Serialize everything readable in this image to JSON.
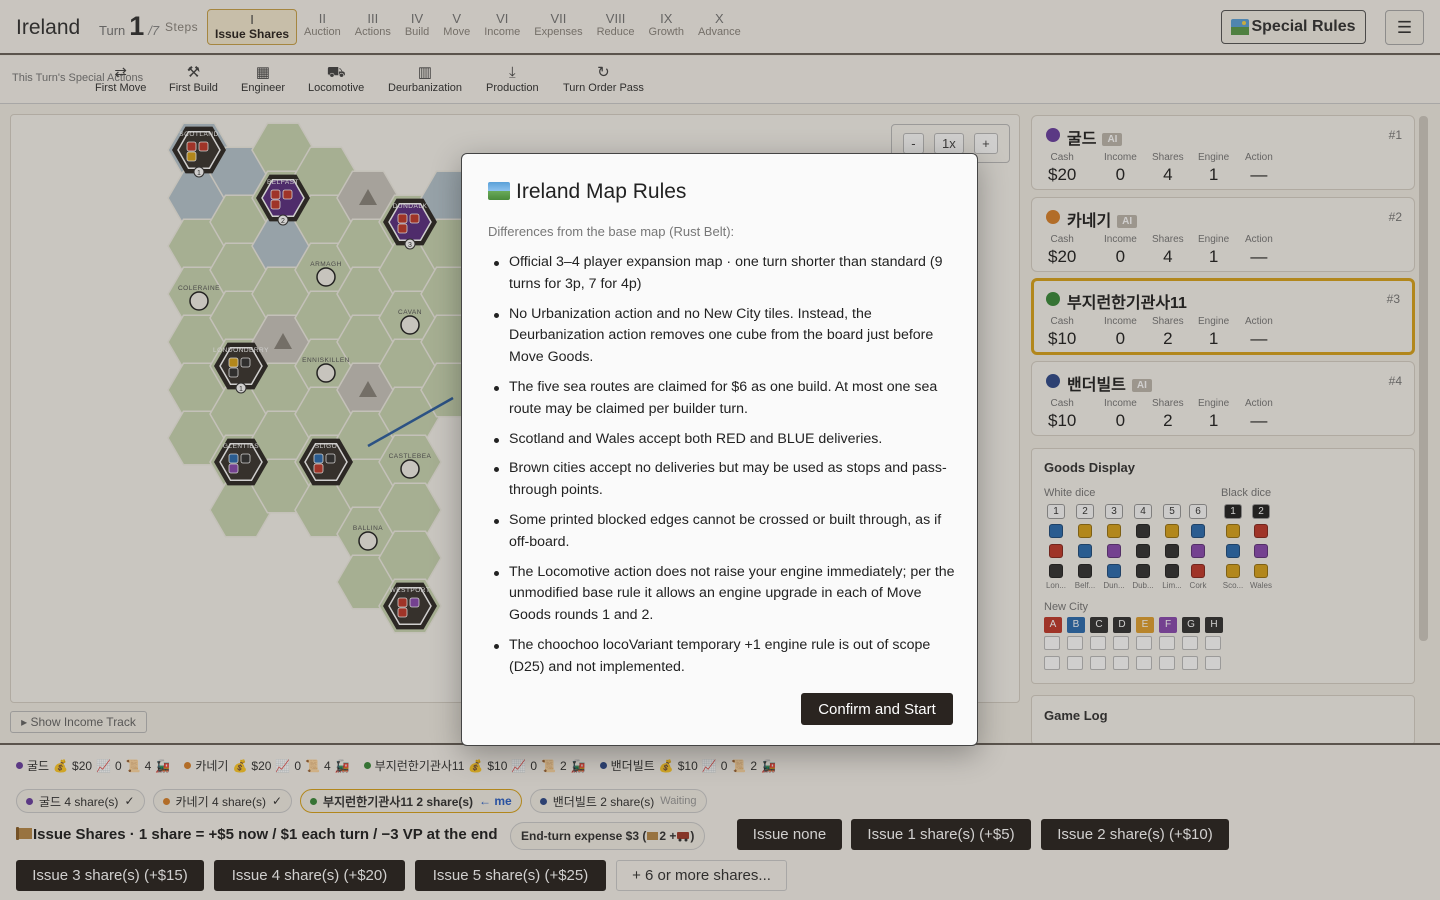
{
  "header": {
    "brand": "Ireland",
    "turn_label": "Turn",
    "turn_number": "1",
    "turn_total": "/7",
    "steps_label": "Steps",
    "steps": [
      {
        "numeral": "I",
        "label": "Issue Shares",
        "active": true
      },
      {
        "numeral": "II",
        "label": "Auction"
      },
      {
        "numeral": "III",
        "label": "Actions"
      },
      {
        "numeral": "IV",
        "label": "Build"
      },
      {
        "numeral": "V",
        "label": "Move"
      },
      {
        "numeral": "VI",
        "label": "Income"
      },
      {
        "numeral": "VII",
        "label": "Expenses"
      },
      {
        "numeral": "VIII",
        "label": "Reduce"
      },
      {
        "numeral": "IX",
        "label": "Growth"
      },
      {
        "numeral": "X",
        "label": "Advance"
      }
    ],
    "special_rules_label": "Special Rules",
    "menu_icon": "hamburger-icon"
  },
  "special_actions": {
    "title": "This Turn's Special Actions",
    "items": [
      {
        "label": "First Move",
        "icon": "arrows-icon"
      },
      {
        "label": "First Build",
        "icon": "hammer-icon"
      },
      {
        "label": "Engineer",
        "icon": "grid-icon"
      },
      {
        "label": "Locomotive",
        "icon": "train-icon"
      },
      {
        "label": "Deurbanization",
        "icon": "city-icon"
      },
      {
        "label": "Production",
        "icon": "download-icon"
      },
      {
        "label": "Turn Order Pass",
        "icon": "refresh-icon"
      }
    ]
  },
  "map": {
    "zoom_minus": "-",
    "zoom_level": "1x",
    "zoom_plus": "+",
    "cities": [
      {
        "name": "SCOTLAND",
        "number": "1"
      },
      {
        "name": "BELFAST",
        "number": "2"
      },
      {
        "name": "DUNDALK",
        "number": "3"
      },
      {
        "name": "ARMAGH"
      },
      {
        "name": "COLERAINE"
      },
      {
        "name": "CAVAN"
      },
      {
        "name": "LONDONDERRY",
        "number": "1"
      },
      {
        "name": "ENNISKILLEN"
      },
      {
        "name": "GLENTIES"
      },
      {
        "name": "SLIGO"
      },
      {
        "name": "CASTLEBEA"
      },
      {
        "name": "BALLINA"
      },
      {
        "name": "WESTPORT"
      }
    ],
    "show_income_label": "▸ Show Income Track"
  },
  "players": [
    {
      "name": "굴드",
      "ai": "AI",
      "rank": "#1",
      "color": "#6a3fa0",
      "cash": "$20",
      "income": "0",
      "shares": "4",
      "engine": "1",
      "action": "—"
    },
    {
      "name": "카네기",
      "ai": "AI",
      "rank": "#2",
      "color": "#d9822b",
      "cash": "$20",
      "income": "0",
      "shares": "4",
      "engine": "1",
      "action": "—"
    },
    {
      "name": "부지런한기관사11",
      "ai": "",
      "rank": "#3",
      "color": "#3a8a3a",
      "cash": "$10",
      "income": "0",
      "shares": "2",
      "engine": "1",
      "action": "—"
    },
    {
      "name": "밴더빌트",
      "ai": "AI",
      "rank": "#4",
      "color": "#2f4a8a",
      "cash": "$10",
      "income": "0",
      "shares": "2",
      "engine": "1",
      "action": "—"
    }
  ],
  "stat_labels": {
    "cash": "Cash",
    "income": "Income",
    "shares": "Shares",
    "engine": "Engine",
    "action": "Action"
  },
  "goods": {
    "title": "Goods Display",
    "white_label": "White dice",
    "black_label": "Black dice",
    "new_city_label": "New City",
    "white_nums": [
      "1",
      "2",
      "3",
      "4",
      "5",
      "6"
    ],
    "black_nums": [
      "1",
      "2"
    ],
    "white_cities": [
      "Lon...",
      "Belf...",
      "Dun...",
      "Dub...",
      "Lim...",
      "Cork"
    ],
    "black_cities": [
      "Sco...",
      "Wales"
    ],
    "letters": [
      "A",
      "B",
      "C",
      "D",
      "E",
      "F",
      "G",
      "H"
    ],
    "letter_colors": [
      "#c0392b",
      "#2b6cb0",
      "#333333",
      "#333333",
      "#e0a030",
      "#8a4ab0",
      "#333333",
      "#333333"
    ]
  },
  "game_log": {
    "title": "Game Log"
  },
  "bottom": {
    "summary": [
      {
        "name": "굴드",
        "cash": "$20",
        "income": "0",
        "shares": "4",
        "color": "#6a3fa0"
      },
      {
        "name": "카네기",
        "cash": "$20",
        "income": "0",
        "shares": "4",
        "color": "#d9822b"
      },
      {
        "name": "부지런한기관사11",
        "cash": "$10",
        "income": "0",
        "shares": "2",
        "color": "#3a8a3a"
      },
      {
        "name": "밴더빌트",
        "cash": "$10",
        "income": "0",
        "shares": "2",
        "color": "#2f4a8a"
      }
    ],
    "pills": [
      {
        "text": "굴드 4 share(s)",
        "suffix": "✓",
        "color": "#6a3fa0"
      },
      {
        "text": "카네기 4 share(s)",
        "suffix": "✓",
        "color": "#d9822b"
      },
      {
        "text": "부지런한기관사11 2 share(s)",
        "suffix": "← me",
        "color": "#3a8a3a",
        "me": true
      },
      {
        "text": "밴더빌트 2 share(s)",
        "suffix": "Waiting",
        "color": "#2f4a8a"
      }
    ],
    "issue_title": "Issue Shares · 1 share = +$5 now / $1 each turn / −3 VP at the end",
    "expense_a": "End-turn expense $3 (",
    "expense_b": "2 + ",
    "expense_c": ")",
    "buttons": [
      "Issue none",
      "Issue 1 share(s) (+$5)",
      "Issue 2 share(s) (+$10)",
      "Issue 3 share(s) (+$15)",
      "Issue 4 share(s) (+$20)",
      "Issue 5 share(s) (+$25)",
      "+ 6 or more shares..."
    ]
  },
  "modal": {
    "title": "Ireland Map Rules",
    "intro": "Differences from the base map (Rust Belt):",
    "rules": [
      "Official 3–4 player expansion map · one turn shorter than standard (9 turns for 3p, 7 for 4p)",
      "No Urbanization action and no New City tiles. Instead, the Deurbanization action removes one cube from the board just before Move Goods.",
      "The five sea routes are claimed for $6 as one build. At most one sea route may be claimed per builder turn.",
      "Scotland and Wales accept both RED and BLUE deliveries.",
      "Brown cities accept no deliveries but may be used as stops and pass-through points.",
      "Some printed blocked edges cannot be crossed or built through, as if off-board.",
      "The Locomotive action does not raise your engine immediately; per the unmodified base rule it allows an engine upgrade in each of Move Goods rounds 1 and 2.",
      "The choochoo locoVariant temporary +1 engine rule is out of scope (D25) and not implemented."
    ],
    "confirm": "Confirm and Start"
  }
}
